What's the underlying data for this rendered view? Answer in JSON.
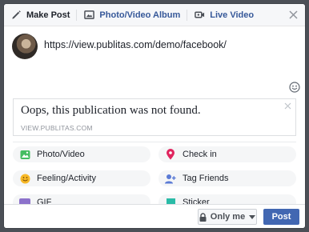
{
  "tabs": [
    {
      "label": "Make Post",
      "icon": "pencil-icon"
    },
    {
      "label": "Photo/Video Album",
      "icon": "album-icon"
    },
    {
      "label": "Live Video",
      "icon": "live-video-icon"
    }
  ],
  "composer": {
    "text": "https://view.publitas.com/demo/facebook/"
  },
  "preview": {
    "title": "Oops, this publication was not found.",
    "domain": "VIEW.PUBLITAS.COM"
  },
  "options": [
    {
      "label": "Photo/Video",
      "icon": "photo-icon",
      "color": "#45bd62"
    },
    {
      "label": "Check in",
      "icon": "location-pin-icon",
      "color": "#e0245e"
    },
    {
      "label": "Feeling/Activity",
      "icon": "smiley-icon",
      "color": "#f7b928"
    },
    {
      "label": "Tag Friends",
      "icon": "tag-friends-icon",
      "color": "#1877f2"
    },
    {
      "label": "GIF",
      "icon": "gif-icon",
      "color": "#8c72cb"
    },
    {
      "label": "Sticker",
      "icon": "sticker-icon",
      "color": "#2abba7"
    }
  ],
  "footer": {
    "audience": "Only me",
    "post_label": "Post"
  },
  "colors": {
    "accent": "#4267b2",
    "link_blue": "#365899"
  }
}
